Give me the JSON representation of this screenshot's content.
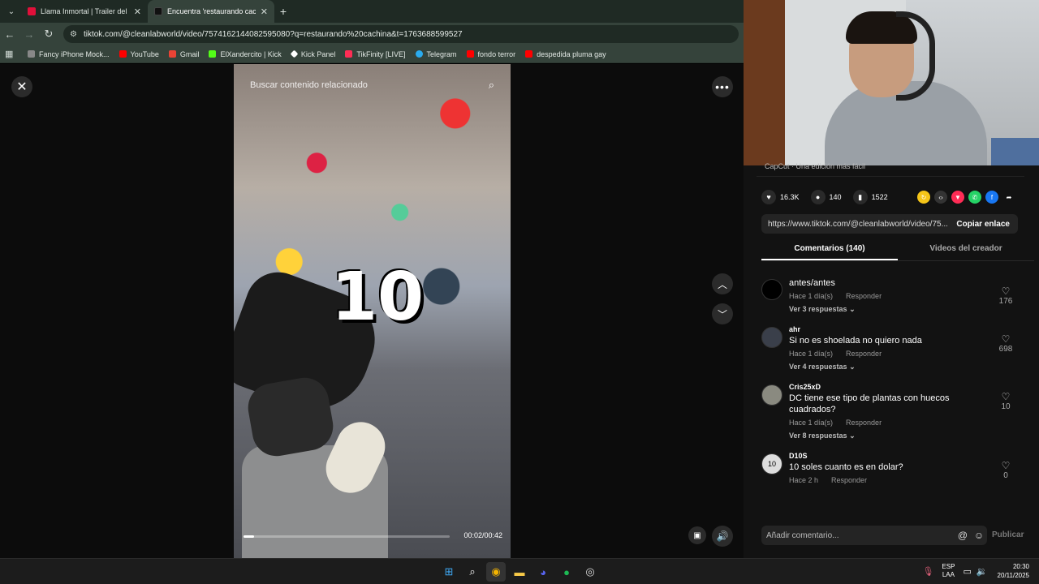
{
  "tabs": [
    {
      "title": "Llama Inmortal | Trailer del Ca...",
      "favicon_color": "#e0103a"
    },
    {
      "title": "Encuentra 'restaurando cachina'",
      "favicon_color": "#111111"
    }
  ],
  "address": {
    "url": "tiktok.com/@cleanlabworld/video/7574162144082595080?q=restaurando%20cachina&t=1763688599527"
  },
  "bookmarks": [
    {
      "label": "Fancy iPhone Mock...",
      "color": "#888888"
    },
    {
      "label": "YouTube",
      "color": "#ff0000"
    },
    {
      "label": "Gmail",
      "color": "#ea4335"
    },
    {
      "label": "ElXandercito | Kick",
      "color": "#53fc18"
    },
    {
      "label": "Kick Panel",
      "color": "#ffffff"
    },
    {
      "label": "TikFinity [LIVE]",
      "color": "#ff2d55"
    },
    {
      "label": "Telegram",
      "color": "#2aabee"
    },
    {
      "label": "fondo terror",
      "color": "#ff0000"
    },
    {
      "label": "despedida pluma gay",
      "color": "#ff0000"
    }
  ],
  "video": {
    "search_placeholder": "Buscar contenido relacionado",
    "overlay_number": "10",
    "time": "00:02/00:42",
    "progress": 0.05
  },
  "panel": {
    "capcut_text": "CapCut · Una edición más fácil",
    "likes": "16.3K",
    "comments_count": "140",
    "saves": "1522",
    "link": "https://www.tiktok.com/@cleanlabworld/video/75...",
    "copy_label": "Copiar enlace",
    "tab_comments": "Comentarios (140)",
    "tab_creator": "Videos del creador",
    "comment_placeholder": "Añadir comentario...",
    "publish_label": "Publicar"
  },
  "comments": [
    {
      "user": "",
      "text": "antes/antes",
      "time": "Hace 1 día(s)",
      "reply": "Responder",
      "replies": "Ver 3 respuestas",
      "likes": "176"
    },
    {
      "user": "ahr",
      "text": "Si no es shoelada no quiero nada",
      "time": "Hace 1 día(s)",
      "reply": "Responder",
      "replies": "Ver 4 respuestas",
      "likes": "698"
    },
    {
      "user": "Cris25xD",
      "text": "DC tiene ese tipo de plantas con huecos cuadrados?",
      "time": "Hace 1 día(s)",
      "reply": "Responder",
      "replies": "Ver 8 respuestas",
      "likes": "10"
    },
    {
      "user": "D10S",
      "text": "10 soles cuanto es en dolar?",
      "time": "Hace 2 h",
      "reply": "Responder",
      "replies": "",
      "likes": "0"
    }
  ],
  "taskbar": {
    "lang_top": "ESP",
    "lang_bottom": "LAA",
    "time": "20:30",
    "date": "20/11/2025"
  }
}
